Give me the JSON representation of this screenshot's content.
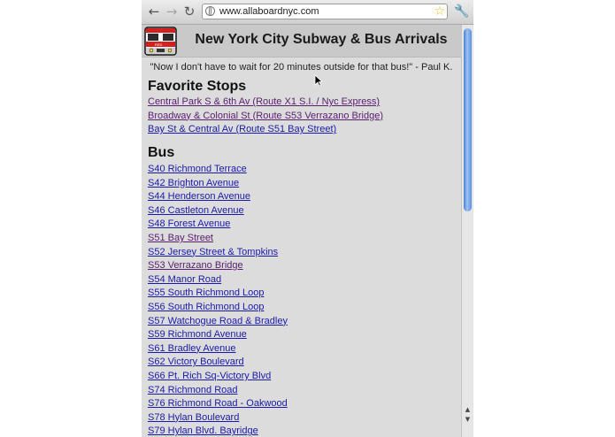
{
  "browser": {
    "url": "www.allaboardnyc.com",
    "nav": {
      "back": "←",
      "forward": "→",
      "reload": "↻"
    },
    "star_glyph": "☆",
    "wrench_glyph": "🔧"
  },
  "page": {
    "title": "New York City Subway & Bus Arrivals",
    "quote": "\"Now I don't have to wait for 20 minutes outside for that bus!\" - Paul K.",
    "favorites": {
      "heading": "Favorite Stops",
      "items": [
        {
          "label": "Central Park S & 6th Av (Route X1 S.I. / Nyc Express)",
          "visited": true
        },
        {
          "label": "Broadway & Colonial St (Route S53 Verrazano Bridge)",
          "visited": true
        },
        {
          "label": "Bay St & Central Av (Route S51 Bay Street)",
          "visited": false
        }
      ]
    },
    "bus": {
      "heading": "Bus",
      "items": [
        {
          "label": "S40 Richmond Terrace",
          "visited": false
        },
        {
          "label": "S42 Brighton Avenue",
          "visited": false
        },
        {
          "label": "S44 Henderson Avenue",
          "visited": false
        },
        {
          "label": "S46 Castleton Avenue",
          "visited": false
        },
        {
          "label": "S48 Forest Avenue",
          "visited": false
        },
        {
          "label": "S51 Bay Street",
          "visited": true
        },
        {
          "label": "S52 Jersey Street & Tompkins",
          "visited": false
        },
        {
          "label": "S53 Verrazano Bridge",
          "visited": true
        },
        {
          "label": "S54 Manor Road",
          "visited": false
        },
        {
          "label": "S55 South Richmond Loop",
          "visited": false
        },
        {
          "label": "S56 South Richmond Loop",
          "visited": false
        },
        {
          "label": "S57 Watchogue Road & Bradley",
          "visited": false
        },
        {
          "label": "S59 Richmond Avenue",
          "visited": false
        },
        {
          "label": "S61 Bradley Avenue",
          "visited": false
        },
        {
          "label": "S62 Victory Boulevard",
          "visited": false
        },
        {
          "label": "S66 Pt. Rich Sq-Victory Blvd",
          "visited": false
        },
        {
          "label": "S74 Richmond Road",
          "visited": false
        },
        {
          "label": "S76 Richmond Road - Oakwood",
          "visited": false
        },
        {
          "label": "S78 Hylan Boulevard",
          "visited": false
        },
        {
          "label": "S79 Hylan Blvd. Bayridge",
          "visited": false
        }
      ]
    }
  },
  "colors": {
    "link": "#1a1aa8",
    "visited_link": "#5a2070",
    "page_background": "#dcdcdc",
    "header_background": "#c9c9c9",
    "scroll_thumb": "#5a8fdf"
  }
}
